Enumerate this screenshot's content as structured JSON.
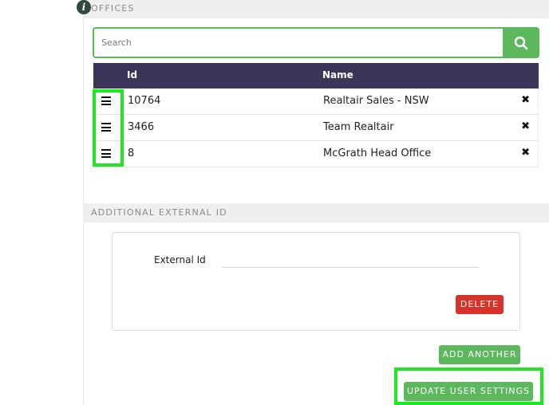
{
  "offices": {
    "header": "OFFICES",
    "info_icon": "i",
    "search": {
      "placeholder": "Search",
      "value": ""
    },
    "table": {
      "columns": [
        "Id",
        "Name"
      ],
      "rows": [
        {
          "id": "10764",
          "name": "Realtair Sales - NSW"
        },
        {
          "id": "3466",
          "name": "Team Realtair"
        },
        {
          "id": "8",
          "name": "McGrath Head Office"
        }
      ]
    },
    "remove_symbol": "✖"
  },
  "external_id": {
    "header": "ADDITIONAL EXTERNAL ID",
    "field_label": "External Id",
    "field_value": "",
    "delete_label": "DELETE",
    "add_another_label": "ADD ANOTHER"
  },
  "update_label": "UPDATE USER SETTINGS",
  "colors": {
    "primary_green": "#5cb85c",
    "danger_red": "#d9322b",
    "table_header": "#3c3559",
    "highlight": "#1ee81e"
  }
}
